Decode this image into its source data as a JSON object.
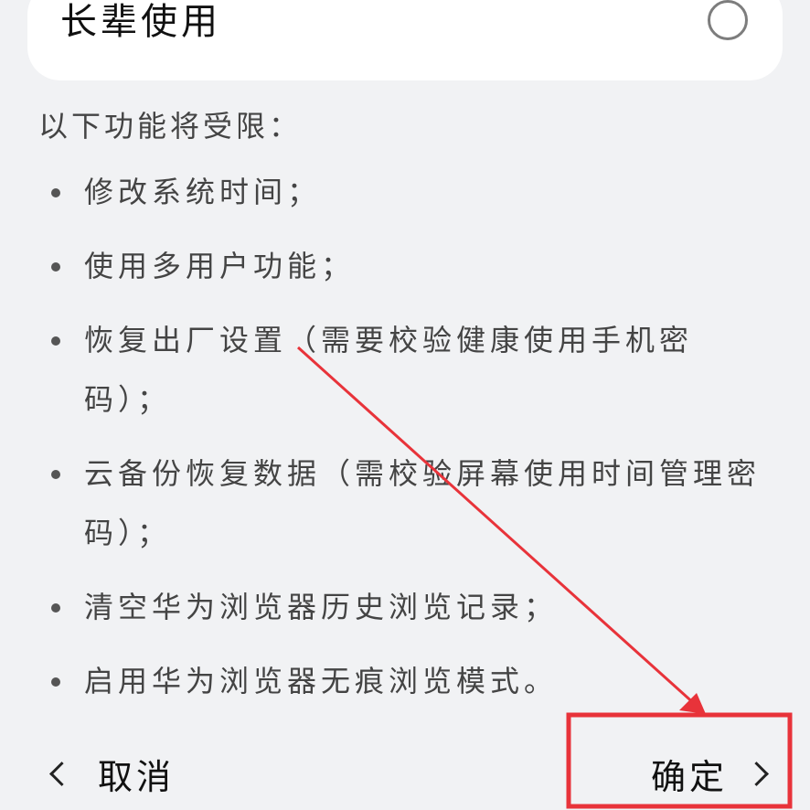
{
  "option": {
    "label": "长辈使用",
    "selected": false
  },
  "restrictions": {
    "heading": "以下功能将受限：",
    "items": [
      "修改系统时间；",
      "使用多用户功能；",
      "恢复出厂设置（需要校验健康使用手机密码）；",
      "云备份恢复数据（需校验屏幕使用时间管理密码）；",
      "清空华为浏览器历史浏览记录；",
      "启用华为浏览器无痕浏览模式。"
    ]
  },
  "footer": {
    "cancel_label": "取消",
    "confirm_label": "确定"
  },
  "colors": {
    "background": "#f1f2f4",
    "card": "#ffffff",
    "annotation_red": "#e8333a"
  },
  "icons": {
    "radio": "radio-unchecked-icon",
    "cancel": "chevron-left-icon",
    "confirm": "chevron-right-icon"
  }
}
